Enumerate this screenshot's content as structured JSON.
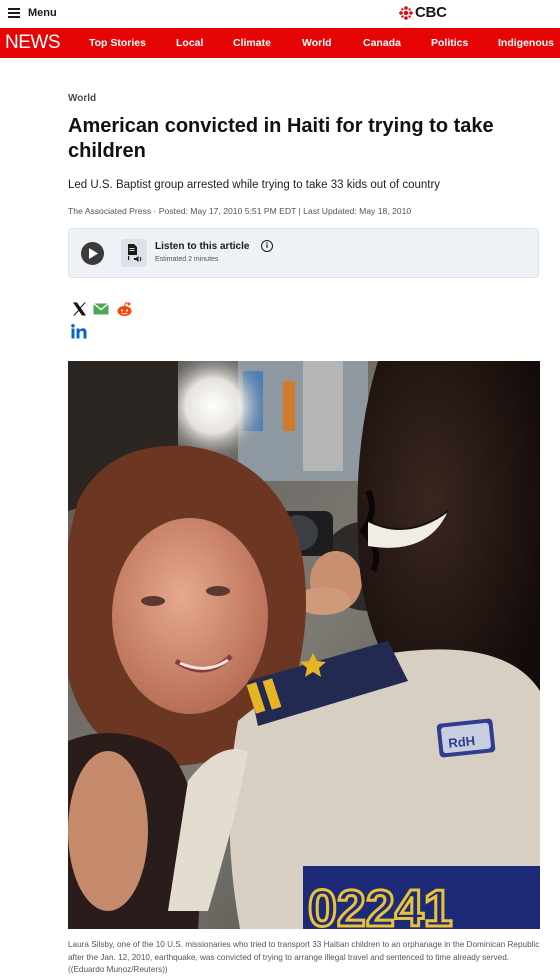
{
  "header": {
    "menu_label": "Menu",
    "brand": "CBC",
    "brand_color": "#e60505"
  },
  "nav": {
    "logo": "NEWS",
    "items": [
      "Top Stories",
      "Local",
      "Climate",
      "World",
      "Canada",
      "Politics",
      "Indigenous"
    ]
  },
  "article": {
    "section": "World",
    "headline": "American convicted in Haiti for trying to take children",
    "deck": "Led U.S. Baptist group arrested while trying to take 33 kids out of country",
    "byline": "The Associated Press · Posted: May 17, 2010 5:51 PM EDT | Last Updated: May 18, 2010"
  },
  "listen": {
    "title": "Listen to this article",
    "estimate": "Estimated 2 minutes",
    "icons": [
      "play-icon",
      "text-to-speech-icon",
      "info-icon"
    ]
  },
  "share": {
    "icons": [
      "x-icon",
      "email-icon",
      "reddit-icon",
      "linkedin-icon"
    ]
  },
  "photo": {
    "badge_text": "RdH",
    "number_text": "02241",
    "caption": "Laura Silsby, one of the 10 U.S. missionaries who tried to transport 33 Haitian children to an orphanage in the Dominican Republic after the Jan. 12, 2010, earthquake, was convicted of trying to arrange illegal travel and sentenced to time already served. ((Eduardo Munoz/Reuters))"
  }
}
